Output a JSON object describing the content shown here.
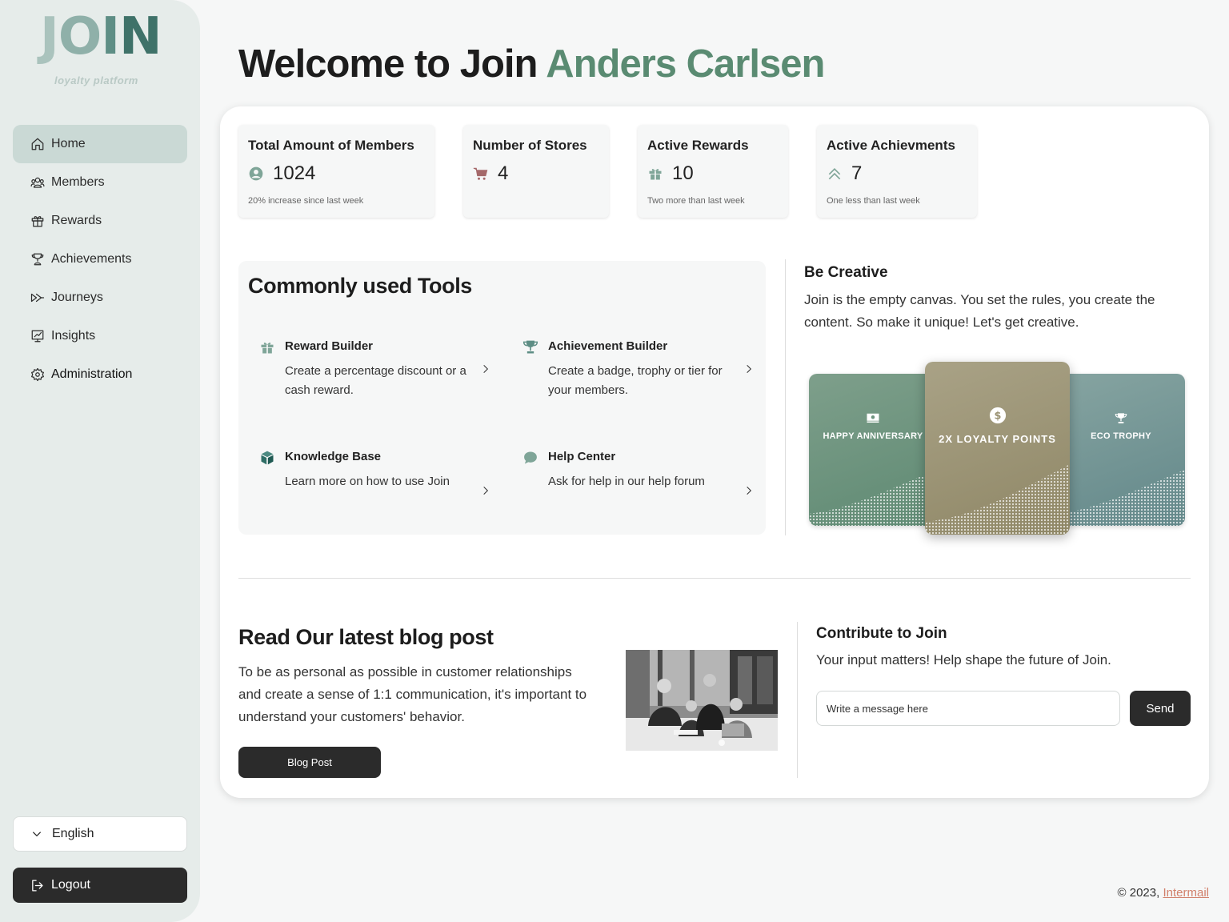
{
  "brand": {
    "logo_letters": [
      "J",
      "O",
      "I",
      "N"
    ],
    "tagline": "loyalty platform"
  },
  "sidebar": {
    "items": [
      {
        "label": "Home",
        "icon": "home-icon",
        "active": true
      },
      {
        "label": "Members",
        "icon": "members-icon"
      },
      {
        "label": "Rewards",
        "icon": "gift-icon"
      },
      {
        "label": "Achievements",
        "icon": "trophy-icon"
      },
      {
        "label": "Journeys",
        "icon": "journey-icon"
      },
      {
        "label": "Insights",
        "icon": "insights-icon"
      },
      {
        "label": "Administration",
        "icon": "gear-icon"
      }
    ],
    "language": "English",
    "logout": "Logout"
  },
  "header": {
    "welcome_prefix": "Welcome to Join",
    "user_name": "Anders Carlsen"
  },
  "stats": [
    {
      "title": "Total Amount of Members",
      "value": "1024",
      "note": "20% increase since last week",
      "icon": "user-circle-icon"
    },
    {
      "title": "Number of Stores",
      "value": "4",
      "note": "",
      "icon": "cart-icon"
    },
    {
      "title": "Active Rewards",
      "value": "10",
      "note": "Two more than last week",
      "icon": "gift-icon"
    },
    {
      "title": "Active Achievments",
      "value": "7",
      "note": "One less than last week",
      "icon": "chevrons-up-icon"
    }
  ],
  "tools": {
    "title": "Commonly used Tools",
    "items": [
      {
        "name": "Reward Builder",
        "desc": "Create a percentage discount or a cash reward.",
        "icon": "gift-icon"
      },
      {
        "name": "Achievement Builder",
        "desc": "Create a badge, trophy or tier for your members.",
        "icon": "trophy-icon"
      },
      {
        "name": "Knowledge Base",
        "desc": "Learn more on how to use Join",
        "icon": "cube-icon"
      },
      {
        "name": "Help Center",
        "desc": "Ask for help in our help forum",
        "icon": "chat-bubble-icon"
      }
    ]
  },
  "creative": {
    "title": "Be Creative",
    "text": "Join is the empty canvas. You set the rules, you create the content. So make it unique! Let's get creative.",
    "cards": [
      {
        "label": "HAPPY ANNIVERSARY",
        "icon": "cash-icon"
      },
      {
        "label": "2X LOYALTY POINTS",
        "icon": "dollar-coin-icon"
      },
      {
        "label": "ECO TROPHY",
        "icon": "trophy-icon"
      }
    ]
  },
  "blog": {
    "title": "Read Our latest blog post",
    "text": "To be as personal as possible in customer relationships and create a sense of 1:1 communication, it's important to understand your customers' behavior.",
    "button": "Blog Post"
  },
  "contribute": {
    "title": "Contribute to Join",
    "text": "Your input matters! Help shape the future of Join.",
    "placeholder": "Write a message here",
    "send": "Send"
  },
  "footer": {
    "copyright": "© 2023,",
    "link": "Intermail"
  },
  "colors": {
    "accent": "#5a8b72",
    "sidebar_bg": "#e6ecea",
    "active_nav": "#cad9d5",
    "dark_button": "#2b2b2b",
    "link": "#d1806b"
  }
}
